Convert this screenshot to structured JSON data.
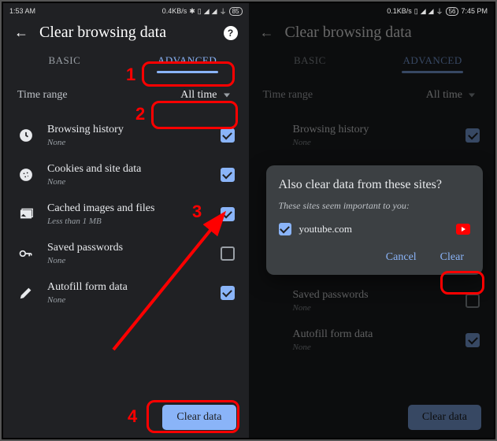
{
  "left": {
    "status": {
      "time": "1:53 AM",
      "net": "0.4KB/s",
      "batt": "85"
    },
    "title": "Clear browsing data",
    "tabs": {
      "basic": "BASIC",
      "advanced": "ADVANCED"
    },
    "timerange": {
      "label": "Time range",
      "value": "All time"
    },
    "items": [
      {
        "label": "Browsing history",
        "sub": "None",
        "checked": true
      },
      {
        "label": "Cookies and site data",
        "sub": "None",
        "checked": true
      },
      {
        "label": "Cached images and files",
        "sub": "Less than 1 MB",
        "checked": true
      },
      {
        "label": "Saved passwords",
        "sub": "None",
        "checked": false
      },
      {
        "label": "Autofill form data",
        "sub": "None",
        "checked": true
      }
    ],
    "clear_btn": "Clear data",
    "annot": {
      "n1": "1",
      "n2": "2",
      "n3": "3",
      "n4": "4"
    }
  },
  "right": {
    "status": {
      "time": "7:45 PM",
      "net": "0.1KB/s",
      "batt": "56"
    },
    "title": "Clear browsing data",
    "tabs": {
      "basic": "BASIC",
      "advanced": "ADVANCED"
    },
    "timerange": {
      "label": "Time range",
      "value": "All time"
    },
    "items": [
      {
        "label": "Browsing history",
        "sub": "None"
      },
      {
        "label": "Saved passwords",
        "sub": "None"
      },
      {
        "label": "Autofill form data",
        "sub": "None"
      }
    ],
    "clear_btn": "Clear data",
    "dialog": {
      "heading": "Also clear data from these sites?",
      "subtext": "These sites seem important to you:",
      "site": "youtube.com",
      "cancel": "Cancel",
      "clear": "Clear"
    }
  }
}
